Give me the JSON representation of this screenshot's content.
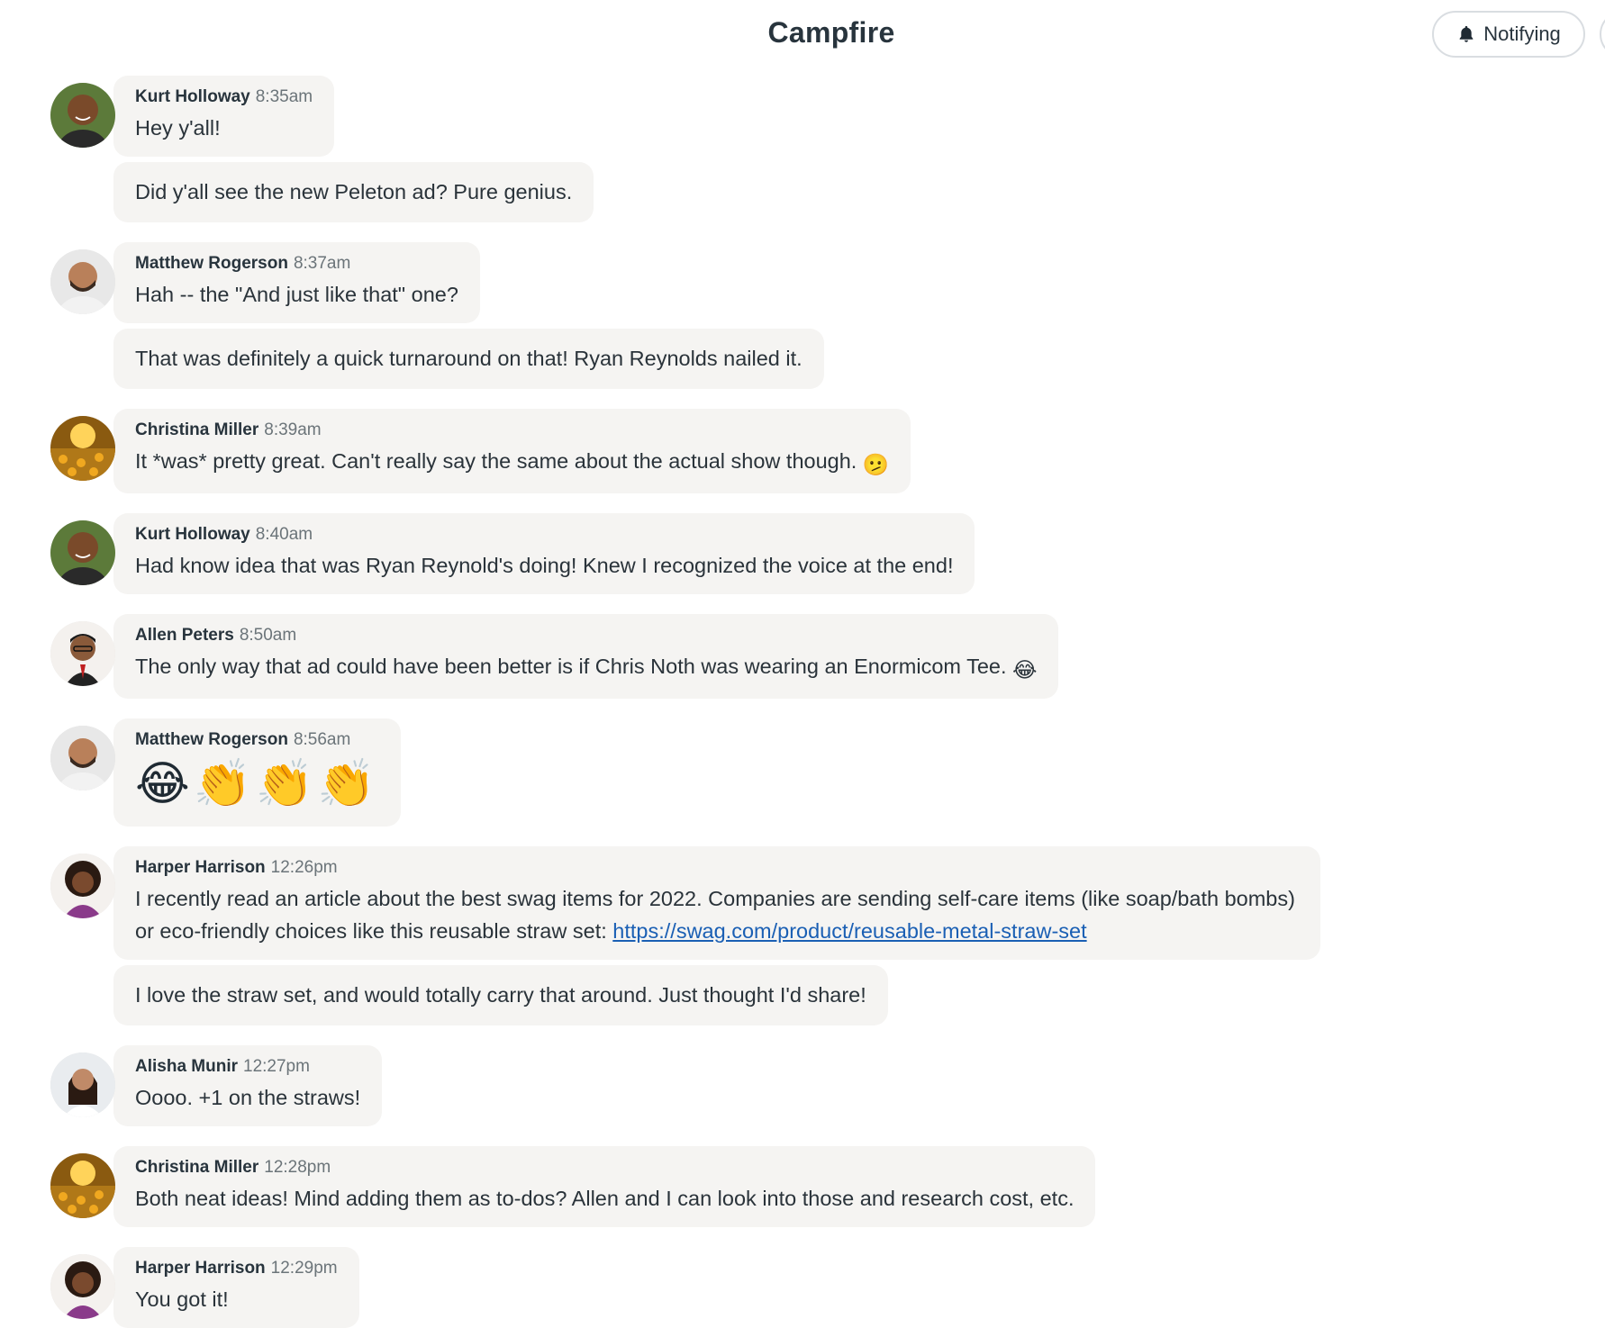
{
  "header": {
    "title": "Campfire",
    "notify_label": "Notifying"
  },
  "messages": [
    {
      "author": "Kurt Holloway",
      "time": "8:35am",
      "lines": [
        "Hey y'all!",
        "Did y'all see the new Peleton ad? Pure genius."
      ]
    },
    {
      "author": "Matthew Rogerson",
      "time": "8:37am",
      "lines": [
        "Hah -- the \"And just like that\" one?",
        "That was definitely a quick turnaround on that! Ryan Reynolds nailed it."
      ]
    },
    {
      "author": "Christina Miller",
      "time": "8:39am",
      "lines": [
        "It *was* pretty great. Can't really say the same about the actual show though."
      ],
      "emoji": "🫤"
    },
    {
      "author": "Kurt Holloway",
      "time": "8:40am",
      "lines": [
        "Had know idea that was Ryan Reynold's doing! Knew I recognized the voice at the end!"
      ]
    },
    {
      "author": "Allen Peters",
      "time": "8:50am",
      "lines": [
        "The only way that ad could have been better is if Chris Noth was wearing an Enormicom Tee."
      ],
      "emoji": "😂"
    },
    {
      "author": "Matthew Rogerson",
      "time": "8:56am",
      "emoji_line": "😂👏👏👏"
    },
    {
      "author": "Harper Harrison",
      "time": "12:26pm",
      "lines": [
        "I recently read an article about the best swag items for 2022. Companies are sending self-care items (like soap/bath bombs) or eco-friendly choices like this reusable straw set:",
        "I love the straw set, and would totally carry that around. Just thought I'd share!"
      ],
      "link": "https://swag.com/product/reusable-metal-straw-set"
    },
    {
      "author": "Alisha Munir",
      "time": "12:27pm",
      "lines": [
        "Oooo. +1 on the straws!"
      ]
    },
    {
      "author": "Christina Miller",
      "time": "12:28pm",
      "lines": [
        "Both neat ideas! Mind adding them as to-dos? Allen and I can look into those and research cost, etc."
      ]
    },
    {
      "author": "Harper Harrison",
      "time": "12:29pm",
      "lines": [
        "You got it!"
      ]
    }
  ]
}
